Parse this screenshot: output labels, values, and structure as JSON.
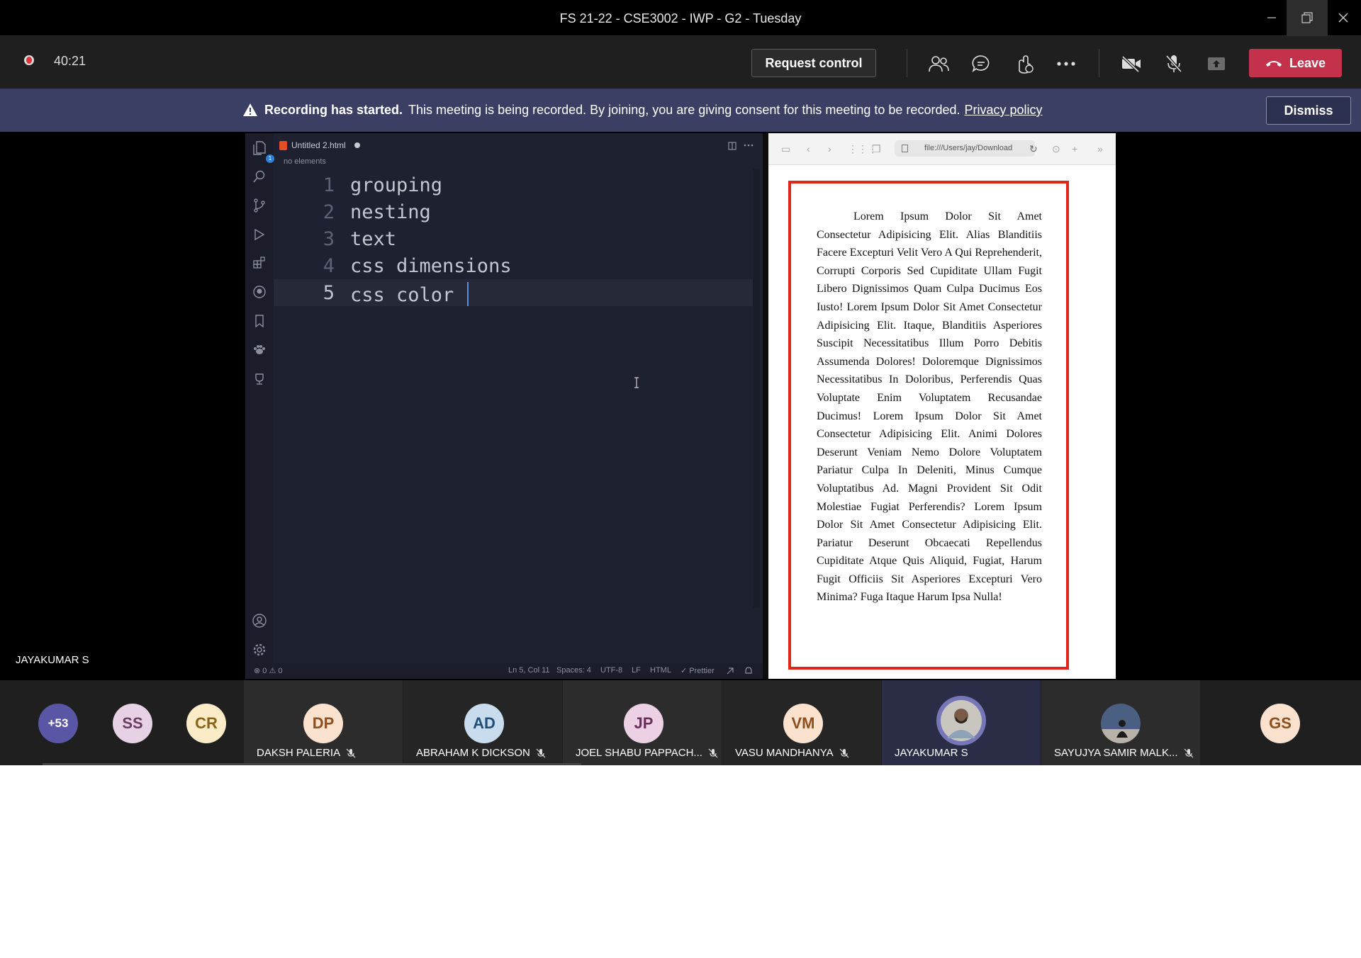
{
  "window": {
    "title": "FS 21-22 - CSE3002 - IWP - G2 - Tuesday"
  },
  "controls": {
    "timer": "40:21",
    "request_control_label": "Request control",
    "leave_label": "Leave"
  },
  "banner": {
    "title": "Recording has started.",
    "message": "This meeting is being recorded. By joining, you are giving consent for this meeting to be recorded.",
    "link": "Privacy policy",
    "dismiss_label": "Dismiss"
  },
  "presenter_name": "JAYAKUMAR S",
  "editor": {
    "tab_title": "Untitled 2.html",
    "breadcrumb": "no elements",
    "activity_badge": "1",
    "lines": [
      {
        "num": "1",
        "text": "grouping"
      },
      {
        "num": "2",
        "text": "nesting"
      },
      {
        "num": "3",
        "text": "text"
      },
      {
        "num": "4",
        "text": "css dimensions"
      },
      {
        "num": "5",
        "text": "css color "
      }
    ],
    "status": {
      "problems": "⊗ 0 ⚠ 0",
      "position": "Ln 5, Col 11",
      "spaces": "Spaces: 4",
      "encoding": "UTF-8",
      "eol": "LF",
      "language": "HTML",
      "formatter": "✓ Prettier"
    }
  },
  "browser": {
    "url": "file:///Users/jay/Download",
    "content": "Lorem Ipsum Dolor Sit Amet Consectetur Adipisicing Elit. Alias Blanditiis Facere Excepturi Velit Vero A Qui Reprehenderit, Corrupti Corporis Sed Cupiditate Ullam Fugit Libero Dignissimos Quam Culpa Ducimus Eos Iusto! Lorem Ipsum Dolor Sit Amet Consectetur Adipisicing Elit. Itaque, Blanditiis Asperiores Suscipit Necessitatibus Illum Porro Debitis Assumenda Dolores! Doloremque Dignissimos Necessitatibus In Doloribus, Perferendis Quas Voluptate Enim Voluptatem Recusandae Ducimus! Lorem Ipsum Dolor Sit Amet Consectetur Adipisicing Elit. Animi Dolores Deserunt Veniam Nemo Dolore Voluptatem Pariatur Culpa In Deleniti, Minus Cumque Voluptatibus Ad. Magni Provident Sit Odit Molestiae Fugiat Perferendis? Lorem Ipsum Dolor Sit Amet Consectetur Adipisicing Elit. Pariatur Deserunt Obcaecati Repellendus Cupiditate Atque Quis Aliquid, Fugiat, Harum Fugit Officiis Sit Asperiores Excepturi Vero Minima? Fuga Itaque Harum Ipsa Nulla!"
  },
  "participants": {
    "overflow": {
      "initials": "+53"
    },
    "avatars": [
      {
        "initials": "SS",
        "bg": "#e6d2e4",
        "fg": "#6b3a66"
      },
      {
        "initials": "CR",
        "bg": "#fbecc7",
        "fg": "#8a6414"
      }
    ],
    "tiles": [
      {
        "initials": "DP",
        "name": "DAKSH PALERIA",
        "bg": "#fbe2cf",
        "fg": "#8f4f1d"
      },
      {
        "initials": "AD",
        "name": "ABRAHAM K DICKSON",
        "bg": "#c9dcee",
        "fg": "#1f4e79"
      },
      {
        "initials": "JP",
        "name": "JOEL SHABU PAPPACH...",
        "bg": "#ebd1e3",
        "fg": "#6b2d5c"
      },
      {
        "initials": "VM",
        "name": "VASU MANDHANYA",
        "bg": "#fbe2cf",
        "fg": "#8f4f1d"
      },
      {
        "initials": "",
        "name": "JAYAKUMAR S"
      },
      {
        "initials": "",
        "name": "SAYUJYA SAMIR MALK..."
      },
      {
        "initials": "GS",
        "name": "",
        "bg": "#fbe2cf",
        "fg": "#8f4f1d"
      }
    ]
  },
  "colors": {
    "leave": "#c4314b",
    "banner": "#3b3f63",
    "recording": "#e0333e",
    "page_border": "#e0251b"
  }
}
